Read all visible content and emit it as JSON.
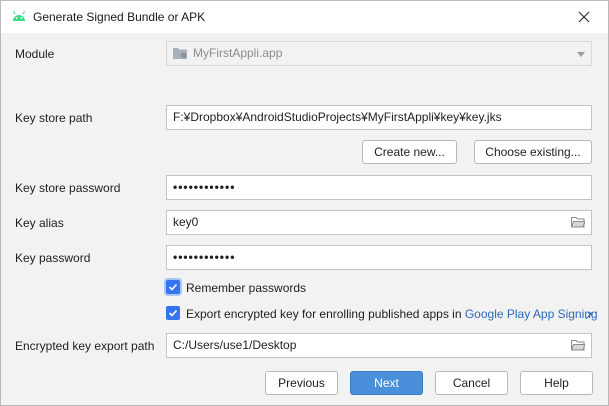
{
  "window": {
    "title": "Generate Signed Bundle or APK",
    "accent_color": "#3dda84"
  },
  "module": {
    "label": "Module",
    "value": "MyFirstAppli.app"
  },
  "keystore": {
    "path_label": "Key store path",
    "path_value": "F:¥Dropbox¥AndroidStudioProjects¥MyFirstAppli¥key¥key.jks",
    "create_new_label": "Create new...",
    "choose_existing_label": "Choose existing...",
    "password_label": "Key store password",
    "password_mask": "••••••••••••"
  },
  "key": {
    "alias_label": "Key alias",
    "alias_value": "key0",
    "password_label": "Key password",
    "password_mask": "••••••••••••"
  },
  "options": {
    "remember_label": "Remember passwords",
    "remember_checked": true,
    "export_label": "Export encrypted key for enrolling published apps in",
    "export_link": "Google Play App Signing",
    "export_checked": true
  },
  "export_path": {
    "label": "Encrypted key export path",
    "value": "C:/Users/use1/Desktop"
  },
  "buttons": {
    "previous": "Previous",
    "next": "Next",
    "cancel": "Cancel",
    "help": "Help"
  }
}
